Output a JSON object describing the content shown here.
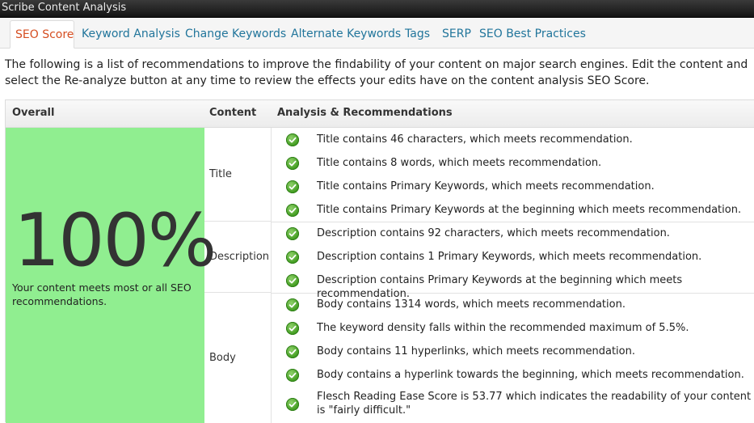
{
  "window": {
    "title": "Scribe Content Analysis"
  },
  "tabs": [
    {
      "label": "SEO Score",
      "active": true
    },
    {
      "label": "Keyword Analysis"
    },
    {
      "label": "Change Keywords"
    },
    {
      "label": "Alternate Keywords"
    },
    {
      "label": "Tags"
    },
    {
      "label": "SERP"
    },
    {
      "label": "SEO Best Practices"
    }
  ],
  "intro": "The following is a list of recommendations to improve the findability of your content on major search engines. Edit the content and select the Re-analyze button at any time to review the effects your edits have on the content analysis SEO Score.",
  "table": {
    "headers": {
      "overall": "Overall",
      "content": "Content",
      "analysis": "Analysis & Recommendations"
    },
    "overall": {
      "score": "100%",
      "message": "Your content meets most or all SEO recommendations.",
      "color": "#90ee90"
    },
    "sections": [
      {
        "name": "Title",
        "items": [
          "Title contains 46 characters, which meets recommendation.",
          "Title contains 8 words, which meets recommendation.",
          "Title contains Primary Keywords, which meets recommendation.",
          "Title contains Primary Keywords at the beginning which meets recommendation."
        ]
      },
      {
        "name": "Description",
        "items": [
          "Description contains 92 characters, which meets recommendation.",
          "Description contains 1 Primary Keywords, which meets recommendation.",
          "Description contains Primary Keywords at the beginning which meets recommendation."
        ]
      },
      {
        "name": "Body",
        "items": [
          "Body contains 1314 words, which meets recommendation.",
          "The keyword density falls within the recommended maximum of 5.5%.",
          "Body contains 11 hyperlinks, which meets recommendation.",
          "Body contains a hyperlink towards the beginning, which meets recommendation.",
          "Flesch Reading Ease Score is 53.77 which indicates the readability of your content is \"fairly difficult.\""
        ]
      }
    ]
  },
  "colors": {
    "accent": "#d54e21",
    "link": "#21759b",
    "pass": "#3e9a1d"
  }
}
